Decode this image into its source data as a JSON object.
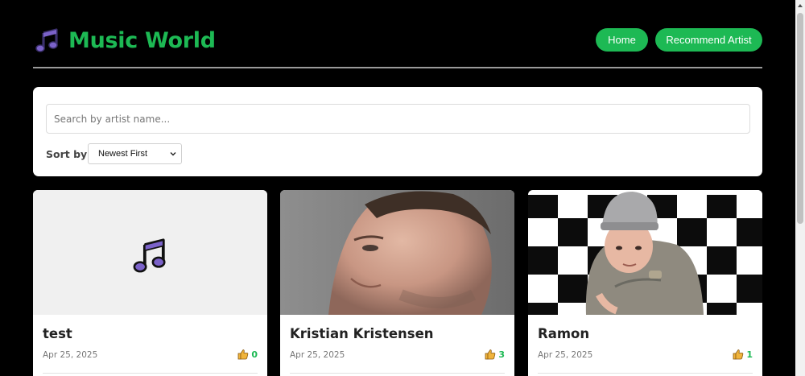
{
  "app": {
    "title": "Music World",
    "logo_icon": "music-note-icon",
    "brand_color": "#1db954"
  },
  "nav": {
    "home_label": "Home",
    "recommend_label": "Recommend Artist"
  },
  "search": {
    "placeholder": "Search by artist name...",
    "value": ""
  },
  "sort": {
    "label": "Sort by:",
    "selected": "Newest First"
  },
  "artists": [
    {
      "name": "test",
      "date": "Apr 25, 2025",
      "likes": "0",
      "image": "music-note-placeholder"
    },
    {
      "name": "Kristian Kristensen",
      "date": "Apr 25, 2025",
      "likes": "3",
      "image": "portrait-photo"
    },
    {
      "name": "Ramon",
      "date": "Apr 25, 2025",
      "likes": "1",
      "image": "checkered-photo"
    }
  ]
}
